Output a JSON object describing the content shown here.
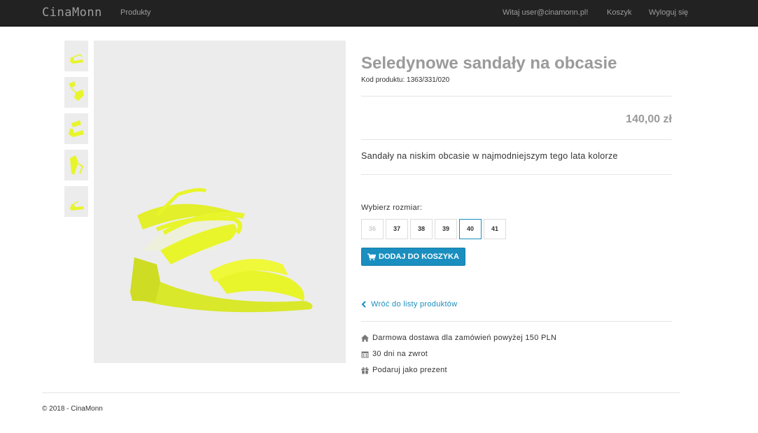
{
  "navbar": {
    "brand": "CinaMonn",
    "products": "Produkty",
    "welcome": "Witaj user@cinamonn.pl!",
    "cart": "Koszyk",
    "logout": "Wyloguj się"
  },
  "product": {
    "title": "Seledynowe sandały na obcasie",
    "code": "Kod produktu: 1363/331/020",
    "price": "140,00 zł",
    "description": "Sandały na niskim obcasie w najmodniejszym tego lata kolorze",
    "size_label": "Wybierz rozmiar:",
    "sizes": [
      "36",
      "37",
      "38",
      "39",
      "40",
      "41"
    ],
    "disabled_size": "36",
    "selected_size": "40",
    "add_to_cart": "DODAJ DO KOSZYKA",
    "back_link": "Wróć do listy produktów",
    "features": [
      {
        "icon": "home-icon",
        "text": "Darmowa dostawa dla zamówień powyżej 150 PLN"
      },
      {
        "icon": "calendar-icon",
        "text": "30 dni na zwrot"
      },
      {
        "icon": "gift-icon",
        "text": "Podaruj jako prezent"
      }
    ]
  },
  "colors": {
    "accent": "#1a8ebf",
    "navbar": "#222222",
    "product": "#e8f52a"
  },
  "footer": {
    "text": "© 2018 - CinaMonn"
  }
}
